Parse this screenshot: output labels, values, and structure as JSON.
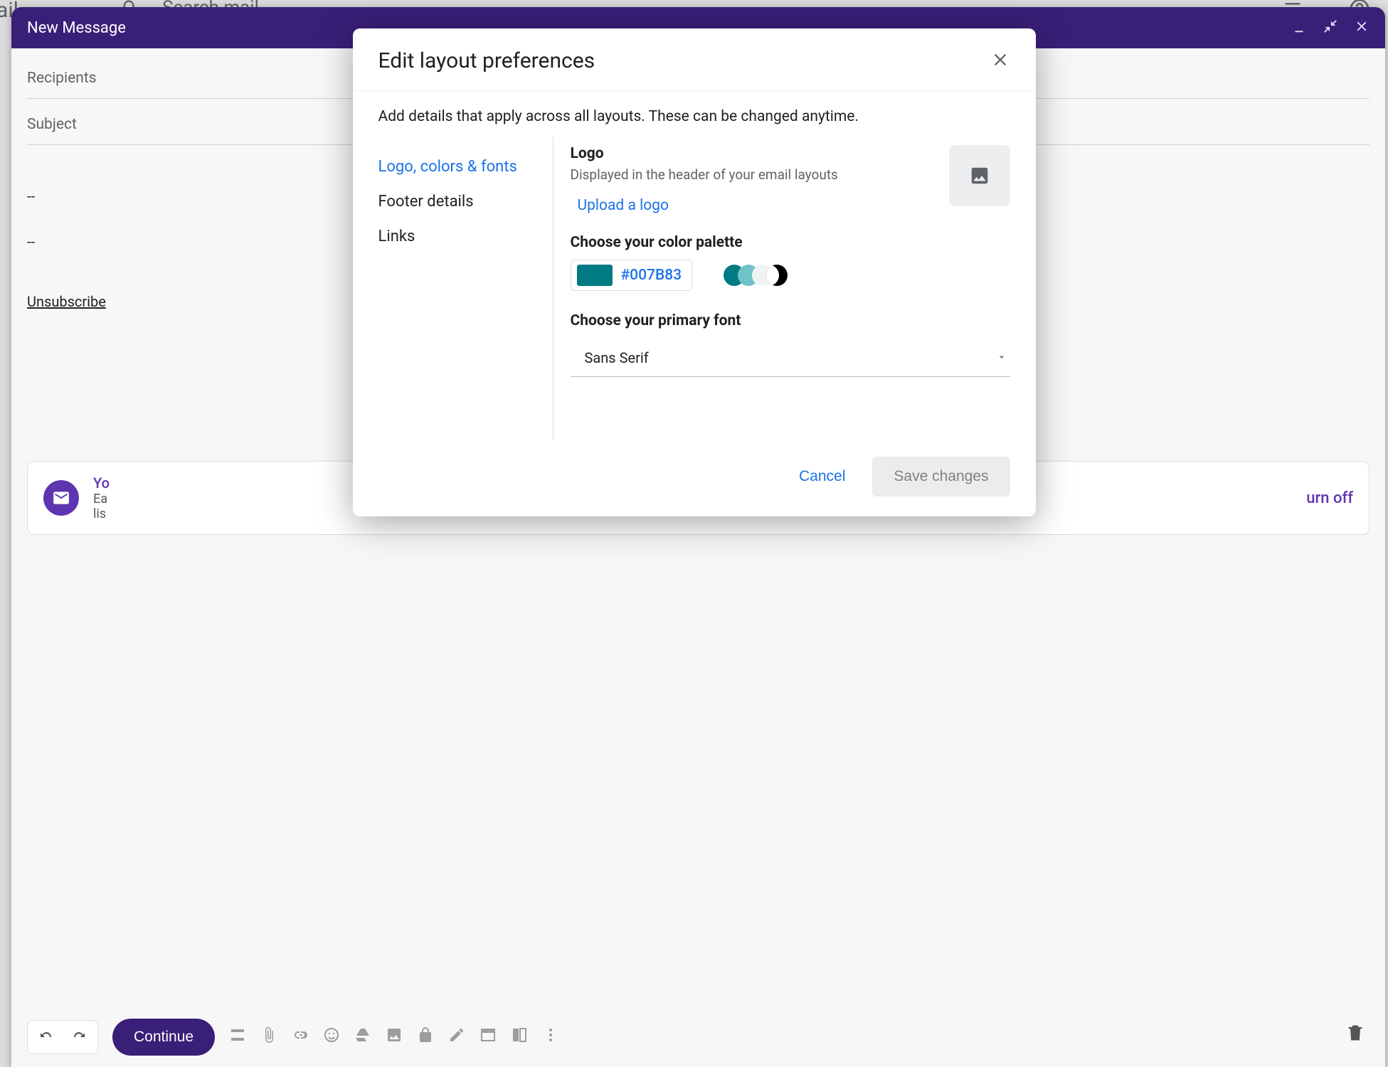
{
  "window": {
    "title": "New Message",
    "recipients_label": "Recipients",
    "subject_label": "Subject",
    "separator": "--",
    "unsubscribe": "Unsubscribe",
    "card_text": "Yo",
    "card_right": "urn off",
    "continue": "Continue"
  },
  "topbar": {
    "mail_frag": "ail",
    "search_placeholder": "Search mail"
  },
  "dialog": {
    "title": "Edit layout preferences",
    "subtitle": "Add details that apply across all layouts. These can be changed anytime.",
    "tabs": {
      "logo": "Logo, colors & fonts",
      "footer": "Footer details",
      "links": "Links"
    },
    "logo": {
      "heading": "Logo",
      "desc": "Displayed in the header of your email layouts",
      "upload": "Upload a logo"
    },
    "palette": {
      "heading": "Choose your color palette",
      "hex": "#007B83",
      "colors": {
        "primary": "#007B83",
        "secondary": "#6FC3C7",
        "light": "#EEF3F4",
        "dark": "#000000"
      }
    },
    "font": {
      "heading": "Choose your primary font",
      "value": "Sans Serif"
    },
    "cancel": "Cancel",
    "save": "Save changes"
  }
}
